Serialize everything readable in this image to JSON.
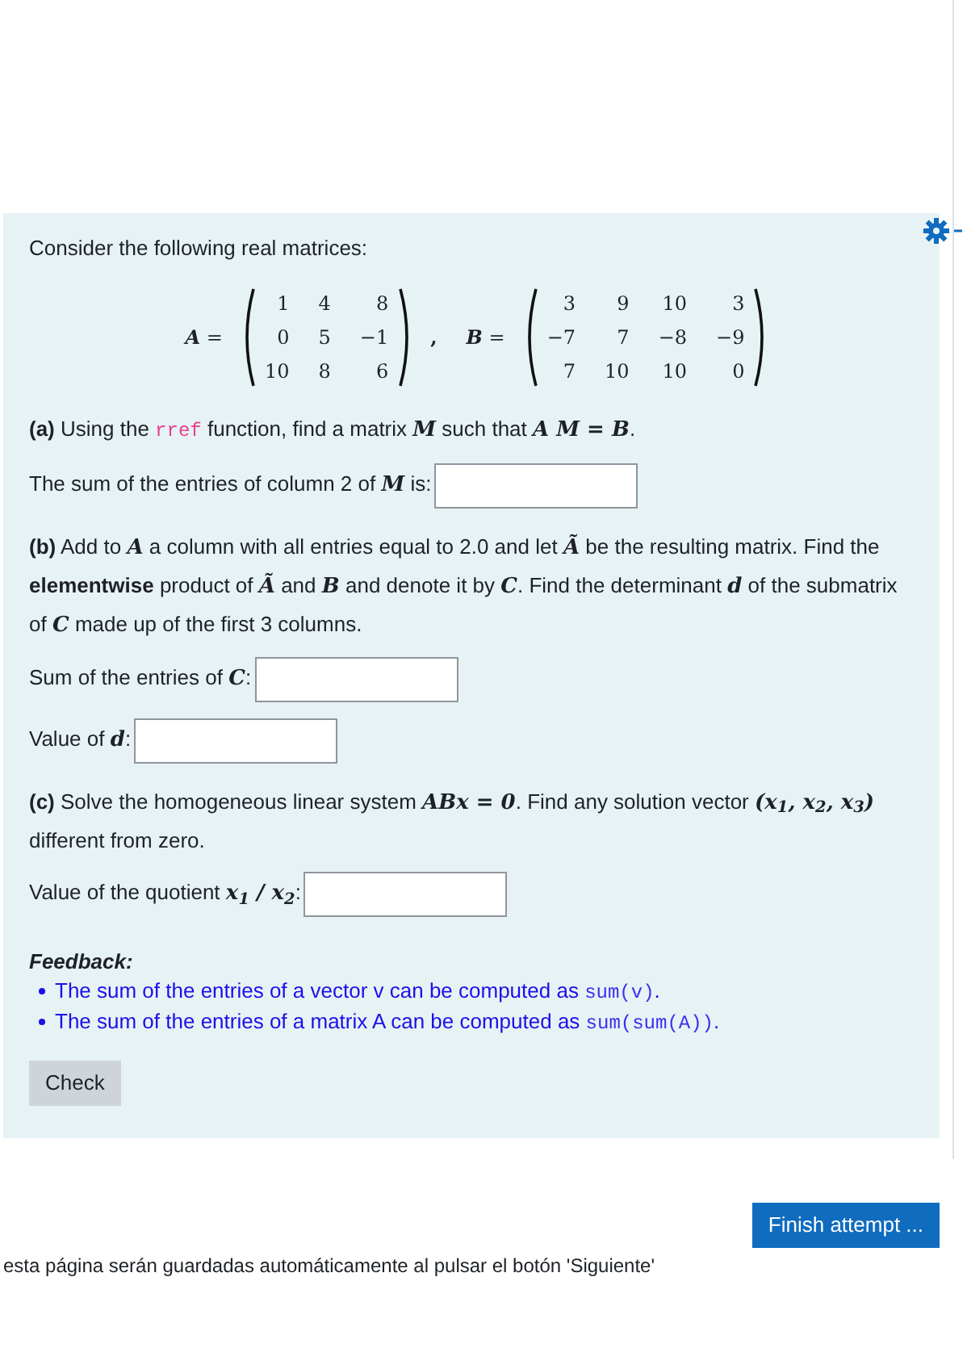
{
  "intro": "Consider the following real matrices:",
  "matrices": [
    {
      "name": "A",
      "sign": "=",
      "rows": [
        [
          "1",
          "4",
          "8"
        ],
        [
          "0",
          "5",
          "−1"
        ],
        [
          "10",
          "8",
          "6"
        ]
      ]
    },
    {
      "name": "B",
      "sign": "=",
      "rows": [
        [
          "3",
          "9",
          "10",
          "3"
        ],
        [
          "−7",
          "7",
          "−8",
          "−9"
        ],
        [
          "7",
          "10",
          "10",
          "0"
        ]
      ]
    }
  ],
  "matrix_separator": ",",
  "parts": [
    {
      "text": [
        {
          "kind": "bold",
          "s": "(a)"
        },
        {
          "kind": "text",
          "s": " Using the "
        },
        {
          "kind": "code",
          "s": "rref"
        },
        {
          "kind": "text",
          "s": " function, find a matrix "
        },
        {
          "kind": "math",
          "s": "M"
        },
        {
          "kind": "text",
          "s": " such that "
        },
        {
          "kind": "math",
          "s": "A M = B"
        },
        {
          "kind": "text",
          "s": "."
        }
      ],
      "answers": [
        {
          "label": [
            {
              "kind": "text",
              "s": "The sum of the entries of column 2 of "
            },
            {
              "kind": "math",
              "s": "M"
            },
            {
              "kind": "text",
              "s": " is:"
            }
          ]
        }
      ]
    },
    {
      "text": [
        {
          "kind": "bold",
          "s": "(b)"
        },
        {
          "kind": "text",
          "s": " Add to "
        },
        {
          "kind": "math",
          "s": "A"
        },
        {
          "kind": "text",
          "s": " a column with all entries equal to 2.0 and let "
        },
        {
          "kind": "math",
          "s": "Ã"
        },
        {
          "kind": "text",
          "s": " be the resulting matrix. Find the "
        },
        {
          "kind": "bold",
          "s": "elementwise"
        },
        {
          "kind": "text",
          "s": " product of "
        },
        {
          "kind": "math",
          "s": "Ã"
        },
        {
          "kind": "text",
          "s": " and "
        },
        {
          "kind": "math",
          "s": "B"
        },
        {
          "kind": "text",
          "s": " and denote it by "
        },
        {
          "kind": "math",
          "s": "C"
        },
        {
          "kind": "text",
          "s": ". Find the determinant "
        },
        {
          "kind": "math",
          "s": "d"
        },
        {
          "kind": "text",
          "s": " of the submatrix of "
        },
        {
          "kind": "math",
          "s": "C"
        },
        {
          "kind": "text",
          "s": " made up of the first 3 columns."
        }
      ],
      "answers": [
        {
          "label": [
            {
              "kind": "text",
              "s": "Sum of the entries of "
            },
            {
              "kind": "math",
              "s": "C"
            },
            {
              "kind": "text",
              "s": ":"
            }
          ]
        },
        {
          "label": [
            {
              "kind": "text",
              "s": "Value of "
            },
            {
              "kind": "math",
              "s": "d"
            },
            {
              "kind": "text",
              "s": ":"
            }
          ]
        }
      ]
    },
    {
      "text": [
        {
          "kind": "bold",
          "s": "(c)"
        },
        {
          "kind": "text",
          "s": " Solve the homogeneous linear system "
        },
        {
          "kind": "math",
          "s": "ABx = 0"
        },
        {
          "kind": "text",
          "s": ". Find any solution vector "
        },
        {
          "kind": "math",
          "s": "(x$_{1}$, x$_{2}$, x$_{3}$)"
        },
        {
          "kind": "text",
          "s": " different from zero."
        }
      ],
      "answers": [
        {
          "label": [
            {
              "kind": "text",
              "s": "Value of the quotient "
            },
            {
              "kind": "math",
              "s": "x$_{1}$ / x$_{2}$"
            },
            {
              "kind": "text",
              "s": ":"
            }
          ]
        }
      ]
    }
  ],
  "feedback": {
    "title": "Feedback:",
    "items": [
      [
        {
          "kind": "text",
          "s": "The sum of the entries of a vector v can be computed as "
        },
        {
          "kind": "code",
          "s": "sum(v)"
        },
        {
          "kind": "text",
          "s": "."
        }
      ],
      [
        {
          "kind": "text",
          "s": "The sum of the entries of a matrix A can be computed as "
        },
        {
          "kind": "code",
          "s": "sum(sum(A))"
        },
        {
          "kind": "text",
          "s": "."
        }
      ]
    ]
  },
  "check_button": "Check",
  "finish_button": "Finish attempt ...",
  "footer_note": "esta página serán guardadas automáticamente al pulsar el botón 'Siguiente'"
}
